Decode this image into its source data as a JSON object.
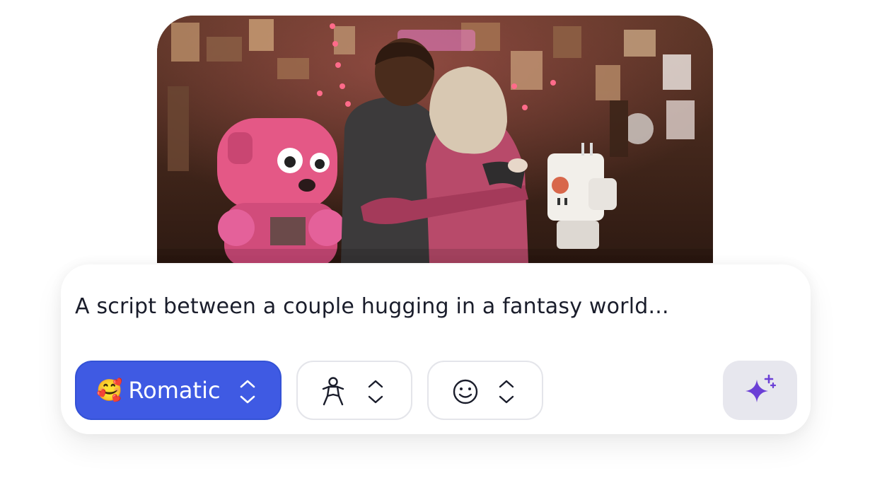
{
  "hero": {
    "image": "illustration-couple-hugging-robots-shop"
  },
  "prompt": {
    "text": "A script between a couple hugging in a fantasy world..."
  },
  "controls": {
    "mood": {
      "emoji": "🥰",
      "label": "Romatic",
      "icon": "chevron-up-down-icon",
      "color": "#3f5ae3"
    },
    "character": {
      "icon": "person-icon",
      "chevron": "chevron-up-down-icon"
    },
    "expression": {
      "icon": "smiley-face-icon",
      "chevron": "chevron-up-down-icon"
    },
    "generate": {
      "icon": "sparkle-icon",
      "color": "#6b3fd6"
    }
  }
}
